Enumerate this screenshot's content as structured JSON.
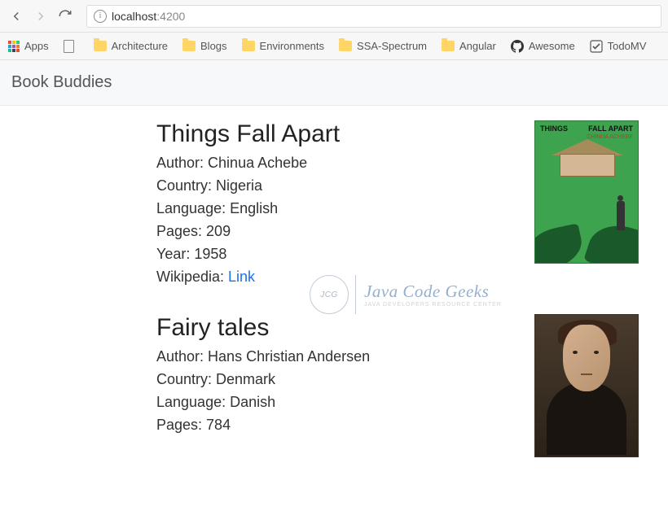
{
  "browser": {
    "url_host": "localhost",
    "url_port": ":4200",
    "apps_label": "Apps",
    "bookmarks": [
      {
        "label": "Architecture",
        "icon": "folder"
      },
      {
        "label": "Blogs",
        "icon": "folder"
      },
      {
        "label": "Environments",
        "icon": "folder"
      },
      {
        "label": "SSA-Spectrum",
        "icon": "folder"
      },
      {
        "label": "Angular",
        "icon": "folder"
      },
      {
        "label": "Awesome",
        "icon": "github"
      },
      {
        "label": "TodoMV",
        "icon": "check"
      }
    ]
  },
  "page": {
    "title": "Book Buddies"
  },
  "labels": {
    "author": "Author: ",
    "country": "Country: ",
    "language": "Language: ",
    "pages": "Pages: ",
    "year": "Year: ",
    "wikipedia": "Wikipedia: ",
    "link": "Link"
  },
  "books": [
    {
      "title": "Things Fall Apart",
      "author": "Chinua Achebe",
      "country": "Nigeria",
      "language": "English",
      "pages": "209",
      "year": "1958",
      "cover_title_left": "THINGS",
      "cover_title_right": "FALL APART",
      "cover_author": "CHINUA ACHEBE"
    },
    {
      "title": "Fairy tales",
      "author": "Hans Christian Andersen",
      "country": "Denmark",
      "language": "Danish",
      "pages": "784"
    }
  ],
  "watermark": {
    "circle": "JCG",
    "text": "Java Code Geeks",
    "sub": "JAVA DEVELOPERS RESOURCE CENTER"
  }
}
